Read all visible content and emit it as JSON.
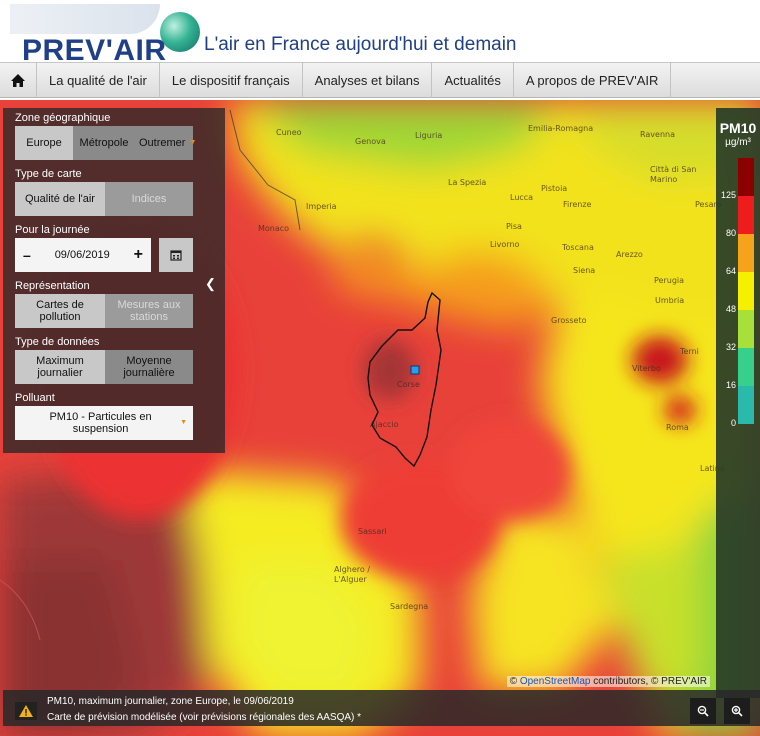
{
  "header": {
    "logo_text": "PREV'AIR",
    "tagline": "L'air en France aujourd'hui et demain"
  },
  "nav": {
    "home_icon": "home-icon",
    "items": [
      "La qualité de l'air",
      "Le dispositif français",
      "Analyses et bilans",
      "Actualités",
      "A propos de PREV'AIR"
    ]
  },
  "panel": {
    "zone_title": "Zone géographique",
    "zone_options": [
      "Europe",
      "Métropole",
      "Outremer"
    ],
    "map_type_title": "Type de carte",
    "map_type_options": [
      "Qualité de l'air",
      "Indices"
    ],
    "day_title": "Pour la journée",
    "date_value": "09/06/2019",
    "decrement_label": "–",
    "increment_label": "+",
    "calendar_icon": "calendar-icon",
    "representation_title": "Représentation",
    "representation_options": [
      "Cartes de pollution",
      "Mesures aux stations"
    ],
    "data_type_title": "Type de données",
    "data_type_options": [
      "Maximum journalier",
      "Moyenne journalière"
    ],
    "pollutant_title": "Polluant",
    "pollutant_value": "PM10 - Particules en suspension"
  },
  "map_labels": [
    "Cuneo",
    "Genova",
    "Liguria",
    "Emilia-Romagna",
    "Ravenna",
    "Imperia",
    "La Spezia",
    "Lucca",
    "Pistoia",
    "Firenze",
    "Città di San Marino",
    "Pesaro",
    "Monaco",
    "Pisa",
    "Livorno",
    "Toscana",
    "Arezzo",
    "Siena",
    "Perugia",
    "Umbria",
    "Grosseto",
    "Terni",
    "Viterbo",
    "Corse",
    "Ajaccio",
    "Roma",
    "Latina",
    "Sassari",
    "Alghero / L'Alguer",
    "Sardegna"
  ],
  "legend": {
    "title": "PM10",
    "unit": "µg/m³",
    "thresholds": [
      "125",
      "80",
      "64",
      "48",
      "32",
      "16",
      "0"
    ],
    "colors": [
      "#8b0000",
      "#ee1c1c",
      "#f6a21a",
      "#f5f000",
      "#a8e03a",
      "#36d08c",
      "#2bb9ac"
    ]
  },
  "attribution": {
    "prefix": "©",
    "link": "OpenStreetMap",
    "suffix": "contributors, © PREV'AIR"
  },
  "footer": {
    "line1": "PM10, maximum journalier, zone Europe, le 09/06/2019",
    "line2": "Carte de prévision modélisée (voir prévisions régionales des AASQA) *"
  }
}
